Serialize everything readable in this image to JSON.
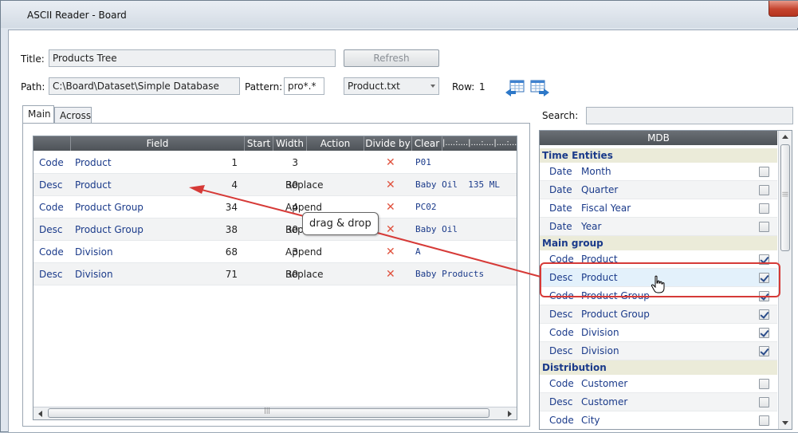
{
  "window": {
    "title": "ASCII Reader - Board"
  },
  "form": {
    "title_label": "Title:",
    "title_value": "Products Tree",
    "refresh_label": "Refresh",
    "path_label": "Path:",
    "path_value": "C:\\Board\\Dataset\\Simple Database",
    "pattern_label": "Pattern:",
    "pattern_value": "pro*.*",
    "file_value": "Product.txt",
    "row_label": "Row:",
    "row_value": "1",
    "search_label": "Search:",
    "search_value": ""
  },
  "icons": {
    "left_arrow": "table-arrow-left-icon",
    "right_arrow": "table-arrow-right-icon"
  },
  "tabs": [
    {
      "label": "Main"
    },
    {
      "label": "Across"
    }
  ],
  "grid": {
    "headers": [
      "Field",
      "Start",
      "Width",
      "Action",
      "Divide by",
      "Clear",
      "|....:....|....:....|....:....|"
    ],
    "rows": [
      {
        "type": "Code",
        "field": "Product",
        "start": "1",
        "width": "3",
        "action": "",
        "preview": "P01"
      },
      {
        "type": "Desc",
        "field": "Product",
        "start": "4",
        "width": "30",
        "action": "Replace",
        "preview": "Baby Oil  135 ML"
      },
      {
        "type": "Code",
        "field": "Product Group",
        "start": "34",
        "width": "4",
        "action": "Append",
        "preview": "PC02"
      },
      {
        "type": "Desc",
        "field": "Product Group",
        "start": "38",
        "width": "30",
        "action": "Replace",
        "preview": "Baby Oil"
      },
      {
        "type": "Code",
        "field": "Division",
        "start": "68",
        "width": "3",
        "action": "Append",
        "preview": "A"
      },
      {
        "type": "Desc",
        "field": "Division",
        "start": "71",
        "width": "30",
        "action": "Replace",
        "preview": "Baby Products"
      }
    ],
    "clear_glyph": "✕",
    "scroll_grip": "|||"
  },
  "mdb": {
    "header": "MDB",
    "groups": [
      {
        "name": "Time Entities",
        "items": [
          {
            "type": "Date",
            "name": "Month",
            "checked": false
          },
          {
            "type": "Date",
            "name": "Quarter",
            "checked": false
          },
          {
            "type": "Date",
            "name": "Fiscal Year",
            "checked": false
          },
          {
            "type": "Date",
            "name": "Year",
            "checked": false
          }
        ]
      },
      {
        "name": "Main group",
        "items": [
          {
            "type": "Code",
            "name": "Product",
            "checked": true
          },
          {
            "type": "Desc",
            "name": "Product",
            "checked": true
          },
          {
            "type": "Code",
            "name": "Product Group",
            "checked": true
          },
          {
            "type": "Desc",
            "name": "Product Group",
            "checked": true
          },
          {
            "type": "Code",
            "name": "Division",
            "checked": true
          },
          {
            "type": "Desc",
            "name": "Division",
            "checked": true
          }
        ]
      },
      {
        "name": "Distribution",
        "items": [
          {
            "type": "Code",
            "name": "Customer",
            "checked": false
          },
          {
            "type": "Desc",
            "name": "Customer",
            "checked": false
          },
          {
            "type": "Code",
            "name": "City",
            "checked": false
          }
        ]
      }
    ],
    "scroll_grip": "|||"
  },
  "annotation": {
    "callout": "drag & drop",
    "color": "#d63a37"
  }
}
